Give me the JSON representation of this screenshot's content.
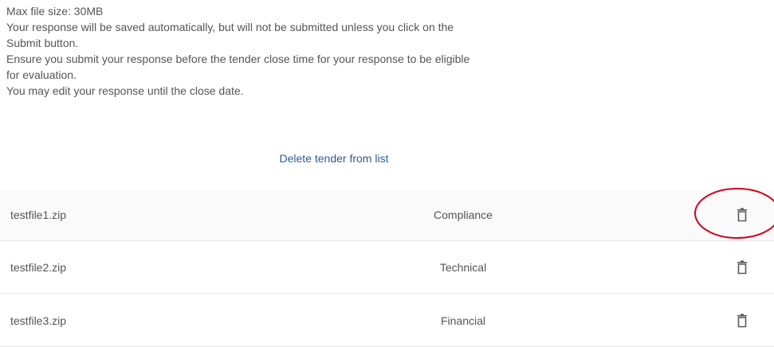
{
  "instructions": {
    "lines": [
      "Max file size: 30MB",
      "Your response will be saved automatically, but will not be submitted unless you click on the",
      "Submit button.",
      "Ensure you submit your response before the tender close time for your response to be eligible",
      "for evaluation.",
      "You may edit your response until the close date."
    ]
  },
  "delete_tender_link": "Delete tender from list",
  "files": [
    {
      "name": "testfile1.zip",
      "category": "Compliance",
      "action_icon": "trash-icon"
    },
    {
      "name": "testfile2.zip",
      "category": "Technical",
      "action_icon": "trash-icon"
    },
    {
      "name": "testfile3.zip",
      "category": "Financial",
      "action_icon": "trash-icon"
    }
  ],
  "colors": {
    "text": "#555555",
    "link": "#2f5e91",
    "icon": "#5a5a5a",
    "annotation": "#d0021b",
    "row_divider": "#e6e6e6"
  }
}
